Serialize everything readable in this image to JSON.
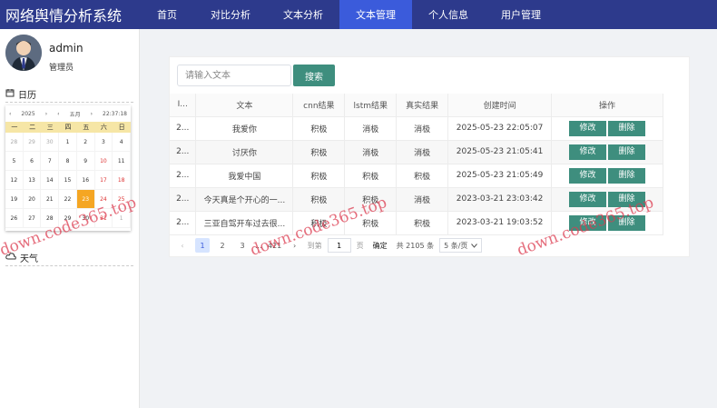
{
  "app": {
    "title": "网络舆情分析系统"
  },
  "nav": [
    {
      "label": "首页"
    },
    {
      "label": "对比分析"
    },
    {
      "label": "文本分析"
    },
    {
      "label": "文本管理",
      "active": true
    },
    {
      "label": "个人信息"
    },
    {
      "label": "用户管理"
    }
  ],
  "user": {
    "name": "admin",
    "role": "管理员"
  },
  "sidebar": {
    "calendar_title": "日历",
    "weather_title": "天气"
  },
  "calendar": {
    "prev_year": "‹",
    "year": "2025",
    "next_year": "›",
    "prev_month": "‹",
    "month": "五月",
    "next_month": "›",
    "time": "22:37:18",
    "weekdays": [
      "一",
      "二",
      "三",
      "四",
      "五",
      "六",
      "日"
    ],
    "days": [
      {
        "d": "28",
        "o": true
      },
      {
        "d": "29",
        "o": true
      },
      {
        "d": "30",
        "o": true
      },
      {
        "d": "1"
      },
      {
        "d": "2"
      },
      {
        "d": "3"
      },
      {
        "d": "4"
      },
      {
        "d": "5"
      },
      {
        "d": "6"
      },
      {
        "d": "7"
      },
      {
        "d": "8"
      },
      {
        "d": "9"
      },
      {
        "d": "10",
        "w": true
      },
      {
        "d": "11"
      },
      {
        "d": "12"
      },
      {
        "d": "13"
      },
      {
        "d": "14"
      },
      {
        "d": "15"
      },
      {
        "d": "16"
      },
      {
        "d": "17",
        "w": true
      },
      {
        "d": "18",
        "w": true
      },
      {
        "d": "19"
      },
      {
        "d": "20"
      },
      {
        "d": "21"
      },
      {
        "d": "22"
      },
      {
        "d": "23",
        "t": true
      },
      {
        "d": "24",
        "w": true
      },
      {
        "d": "25",
        "w": true
      },
      {
        "d": "26"
      },
      {
        "d": "27"
      },
      {
        "d": "28"
      },
      {
        "d": "29"
      },
      {
        "d": "30"
      },
      {
        "d": "31",
        "w": true
      },
      {
        "d": "1",
        "o": true
      }
    ]
  },
  "search": {
    "placeholder": "请输入文本",
    "button_label": "搜索"
  },
  "table": {
    "headers": [
      "I...",
      "文本",
      "cnn结果",
      "lstm结果",
      "真实结果",
      "创建时间",
      "操作"
    ],
    "rows": [
      {
        "id": "2...",
        "text": "我爱你",
        "cnn": "积极",
        "lstm": "消极",
        "real": "消极",
        "time": "2025-05-23 22:05:07"
      },
      {
        "id": "2...",
        "text": "讨厌你",
        "cnn": "积极",
        "lstm": "消极",
        "real": "消极",
        "time": "2025-05-23 21:05:41"
      },
      {
        "id": "2...",
        "text": "我爱中国",
        "cnn": "积极",
        "lstm": "积极",
        "real": "积极",
        "time": "2025-05-23 21:05:49"
      },
      {
        "id": "2...",
        "text": "今天真是个开心的一...",
        "cnn": "积极",
        "lstm": "积极",
        "real": "消极",
        "time": "2023-03-21 23:03:42"
      },
      {
        "id": "2...",
        "text": "三亚自驾开车过去很...",
        "cnn": "积极",
        "lstm": "积极",
        "real": "积极",
        "time": "2023-03-21 19:03:52"
      }
    ],
    "edit_label": "修改",
    "delete_label": "删除"
  },
  "pagination": {
    "prev": "‹",
    "pages": [
      "1",
      "2",
      "3"
    ],
    "ellipsis": "...",
    "last_page": "421",
    "next": "›",
    "goto_label": "到第",
    "goto_value": "1",
    "page_unit": "页",
    "confirm_label": "确定",
    "total_text": "共 2105 条",
    "page_size": "5 条/页"
  },
  "watermark": "down.code365.top"
}
